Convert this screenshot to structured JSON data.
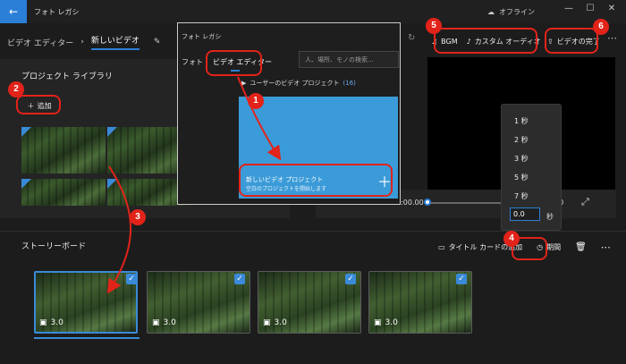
{
  "app": {
    "title": "フォト レガシ",
    "offline_label": "オフライン",
    "window_controls": [
      "minimize-icon",
      "maximize-icon",
      "close-icon"
    ]
  },
  "breadcrumb": {
    "root": "ビデオ エディター",
    "current": "新しいビデオ"
  },
  "library": {
    "title": "プロジェクト ライブラリ",
    "add_label": "追加"
  },
  "top_actions": {
    "bgm_label": "BGM",
    "custom_audio_label": "カスタム オーディオ",
    "finish_label": "ビデオの完了"
  },
  "player": {
    "time_left": "0:00.00",
    "time_right": "00"
  },
  "duration_menu": {
    "options": [
      "1 秒",
      "2 秒",
      "3 秒",
      "5 秒",
      "7 秒"
    ],
    "input_value": "0.0",
    "unit": "秒"
  },
  "storyboard": {
    "title": "ストーリーボード",
    "title_card_label": "タイトル カードの追加",
    "duration_label": "期間",
    "clips": [
      {
        "duration": "3.0"
      },
      {
        "duration": "3.0"
      },
      {
        "duration": "3.0"
      },
      {
        "duration": "3.0"
      }
    ]
  },
  "popup": {
    "title": "フォト レガシ",
    "tab_photo": "フォト",
    "tab_editor": "ビデオ エディター",
    "search_placeholder": "人、場所、モノの検索...",
    "user_projects_label": "ユーザーのビデオ プロジェクト",
    "user_projects_count": "(16)",
    "new_project_title": "新しいビデオ プロジェクト",
    "new_project_subtitle": "空白のプロジェクトを開始します"
  },
  "annotations": [
    "1",
    "2",
    "3",
    "4",
    "5",
    "6"
  ],
  "colors": {
    "accent": "#2b7fd6",
    "annotation_red": "#e2231a",
    "tile_blue": "#3b9bd8"
  }
}
